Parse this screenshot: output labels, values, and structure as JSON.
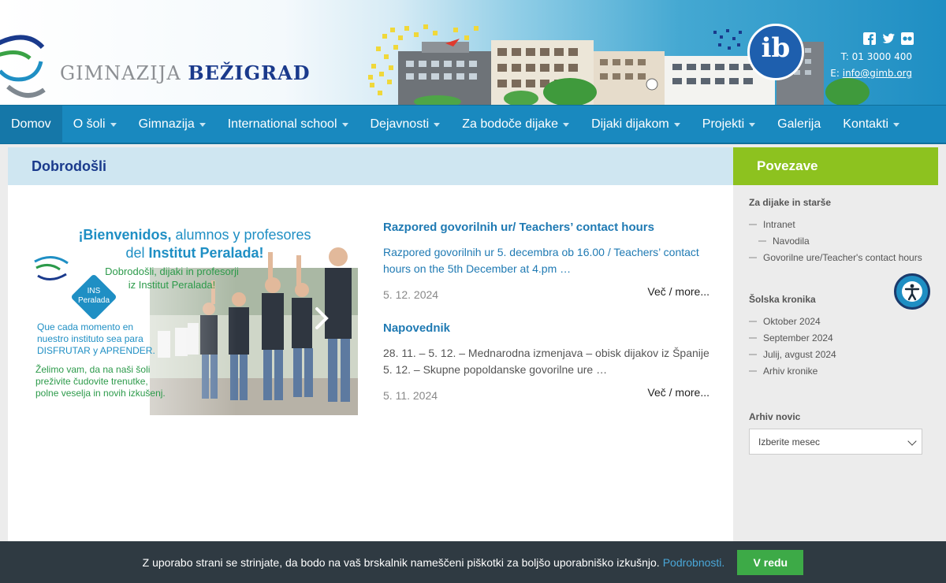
{
  "header": {
    "logo_part1": "GIMNAZIJA",
    "logo_part2": "BEŽIGRAD",
    "ib_logo_text": "ib",
    "social_icons": [
      "facebook-icon",
      "twitter-icon",
      "flickr-icon"
    ],
    "phone": "T: 01 3000 400",
    "email_prefix": "E:",
    "email": "info@gimb.org"
  },
  "nav": {
    "items": [
      {
        "label": "Domov",
        "dropdown": false
      },
      {
        "label": "O šoli",
        "dropdown": true
      },
      {
        "label": "Gimnazija",
        "dropdown": true
      },
      {
        "label": "International school",
        "dropdown": true
      },
      {
        "label": "Dejavnosti",
        "dropdown": true
      },
      {
        "label": "Za bodoče dijake",
        "dropdown": true
      },
      {
        "label": "Dijaki dijakom",
        "dropdown": true
      },
      {
        "label": "Projekti",
        "dropdown": true
      },
      {
        "label": "Galerija",
        "dropdown": false
      },
      {
        "label": "Kontakti",
        "dropdown": true
      }
    ]
  },
  "main": {
    "title": "Dobrodošli",
    "slide": {
      "head1_a": "¡Bienvenidos,",
      "head1_b": " alumnos y profesores",
      "head2_a": "del ",
      "head2_b": "Institut Peralada!",
      "subtitle_line1": "Dobrodošli, dijaki in profesorji",
      "subtitle_line2": "iz Institut Peralada!",
      "badge_line1": "INS",
      "badge_line2": "Peralada",
      "es_line1": "Que cada momento en",
      "es_line2": "nuestro instituto sea para",
      "es_line3": "DISFRUTAR y APRENDER.",
      "sl_line1": "Želimo vam, da na naši šoli",
      "sl_line2": "preživite čudovite trenutke,",
      "sl_line3": "polne veselja in novih izkušenj."
    },
    "news": [
      {
        "title": "Razpored govorilnih ur/ Teachers’ contact hours",
        "excerpt": "Razpored govorilnih ur 5. decembra ob 16.00  / Teachers’ contact hours on the 5th December at 4.pm …",
        "date": "5. 12. 2024",
        "more": "Več / more..."
      },
      {
        "title": "Napovednik",
        "excerpt": "28. 11. – 5. 12. – Mednarodna izmenjava – obisk dijakov iz Španije 5. 12. – Skupne popoldanske govorilne ure …",
        "date": "5. 11. 2024",
        "more": "Več / more..."
      }
    ]
  },
  "sidebar": {
    "title": "Povezave",
    "section1": {
      "heading": "Za dijake in starše",
      "items": [
        "Intranet",
        "Navodila",
        "Govorilne ure/Teacher's contact hours"
      ]
    },
    "section2": {
      "heading": "Šolska kronika",
      "items": [
        "Oktober 2024",
        "September 2024",
        "Julij, avgust 2024",
        "Arhiv kronike"
      ]
    },
    "section3": {
      "heading": "Arhiv novic",
      "select_value": "Izberite mesec"
    }
  },
  "cookie": {
    "text": "Z uporabo strani se strinjate, da bodo na vaš brskalnik nameščeni piškotki za boljšo uporabniško izkušnjo.",
    "link": "Podrobnosti.",
    "button": "V redu"
  },
  "colors": {
    "nav_bg": "#1989bf",
    "title_blue": "#1a3a8c",
    "link_blue": "#1f7ab3",
    "sidebar_accent": "#8dc21f",
    "cookie_bg": "#2f3a42",
    "cookie_button": "#3daa47"
  }
}
